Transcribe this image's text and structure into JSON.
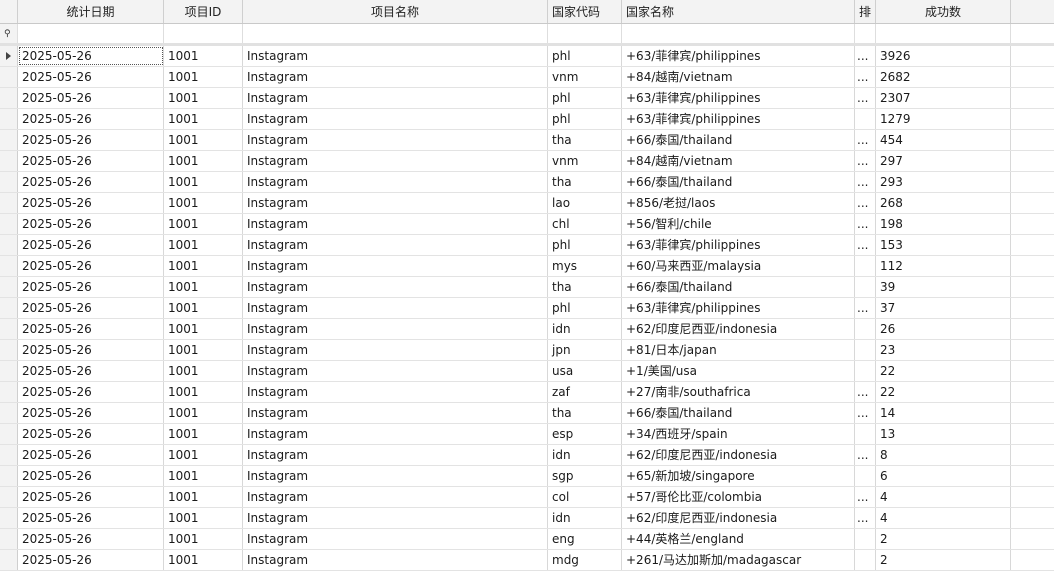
{
  "columns": {
    "date": "统计日期",
    "project_id": "项目ID",
    "project_name": "项目名称",
    "country_code": "国家代码",
    "country_name": "国家名称",
    "truncated": "排",
    "success": "成功数"
  },
  "rows": [
    {
      "date": "2025-05-26",
      "pid": "1001",
      "pname": "Instagram",
      "cc": "phl",
      "cname": "+63/菲律宾/philippines",
      "x": "...",
      "succ": "3926"
    },
    {
      "date": "2025-05-26",
      "pid": "1001",
      "pname": "Instagram",
      "cc": "vnm",
      "cname": "+84/越南/vietnam",
      "x": "...",
      "succ": "2682"
    },
    {
      "date": "2025-05-26",
      "pid": "1001",
      "pname": "Instagram",
      "cc": "phl",
      "cname": "+63/菲律宾/philippines",
      "x": "...",
      "succ": "2307"
    },
    {
      "date": "2025-05-26",
      "pid": "1001",
      "pname": "Instagram",
      "cc": "phl",
      "cname": "+63/菲律宾/philippines",
      "x": "",
      "succ": "1279"
    },
    {
      "date": "2025-05-26",
      "pid": "1001",
      "pname": "Instagram",
      "cc": "tha",
      "cname": "+66/泰国/thailand",
      "x": "...",
      "succ": "454"
    },
    {
      "date": "2025-05-26",
      "pid": "1001",
      "pname": "Instagram",
      "cc": "vnm",
      "cname": "+84/越南/vietnam",
      "x": "...",
      "succ": "297"
    },
    {
      "date": "2025-05-26",
      "pid": "1001",
      "pname": "Instagram",
      "cc": "tha",
      "cname": "+66/泰国/thailand",
      "x": "...",
      "succ": "293"
    },
    {
      "date": "2025-05-26",
      "pid": "1001",
      "pname": "Instagram",
      "cc": "lao",
      "cname": "+856/老挝/laos",
      "x": "...",
      "succ": "268"
    },
    {
      "date": "2025-05-26",
      "pid": "1001",
      "pname": "Instagram",
      "cc": "chl",
      "cname": "+56/智利/chile",
      "x": "...",
      "succ": "198"
    },
    {
      "date": "2025-05-26",
      "pid": "1001",
      "pname": "Instagram",
      "cc": "phl",
      "cname": "+63/菲律宾/philippines",
      "x": "...",
      "succ": "153"
    },
    {
      "date": "2025-05-26",
      "pid": "1001",
      "pname": "Instagram",
      "cc": "mys",
      "cname": "+60/马来西亚/malaysia",
      "x": "",
      "succ": "112"
    },
    {
      "date": "2025-05-26",
      "pid": "1001",
      "pname": "Instagram",
      "cc": "tha",
      "cname": "+66/泰国/thailand",
      "x": "",
      "succ": "39"
    },
    {
      "date": "2025-05-26",
      "pid": "1001",
      "pname": "Instagram",
      "cc": "phl",
      "cname": "+63/菲律宾/philippines",
      "x": "...",
      "succ": "37"
    },
    {
      "date": "2025-05-26",
      "pid": "1001",
      "pname": "Instagram",
      "cc": "idn",
      "cname": "+62/印度尼西亚/indonesia",
      "x": "",
      "succ": "26"
    },
    {
      "date": "2025-05-26",
      "pid": "1001",
      "pname": "Instagram",
      "cc": "jpn",
      "cname": "+81/日本/japan",
      "x": "",
      "succ": "23"
    },
    {
      "date": "2025-05-26",
      "pid": "1001",
      "pname": "Instagram",
      "cc": "usa",
      "cname": "+1/美国/usa",
      "x": "",
      "succ": "22"
    },
    {
      "date": "2025-05-26",
      "pid": "1001",
      "pname": "Instagram",
      "cc": "zaf",
      "cname": "+27/南非/southafrica",
      "x": "...",
      "succ": "22"
    },
    {
      "date": "2025-05-26",
      "pid": "1001",
      "pname": "Instagram",
      "cc": "tha",
      "cname": "+66/泰国/thailand",
      "x": "...",
      "succ": "14"
    },
    {
      "date": "2025-05-26",
      "pid": "1001",
      "pname": "Instagram",
      "cc": "esp",
      "cname": "+34/西班牙/spain",
      "x": "",
      "succ": "13"
    },
    {
      "date": "2025-05-26",
      "pid": "1001",
      "pname": "Instagram",
      "cc": "idn",
      "cname": "+62/印度尼西亚/indonesia",
      "x": "...",
      "succ": "8"
    },
    {
      "date": "2025-05-26",
      "pid": "1001",
      "pname": "Instagram",
      "cc": "sgp",
      "cname": "+65/新加坡/singapore",
      "x": "",
      "succ": "6"
    },
    {
      "date": "2025-05-26",
      "pid": "1001",
      "pname": "Instagram",
      "cc": "col",
      "cname": "+57/哥伦比亚/colombia",
      "x": "...",
      "succ": "4"
    },
    {
      "date": "2025-05-26",
      "pid": "1001",
      "pname": "Instagram",
      "cc": "idn",
      "cname": "+62/印度尼西亚/indonesia",
      "x": "...",
      "succ": "4"
    },
    {
      "date": "2025-05-26",
      "pid": "1001",
      "pname": "Instagram",
      "cc": "eng",
      "cname": "+44/英格兰/england",
      "x": "",
      "succ": "2"
    },
    {
      "date": "2025-05-26",
      "pid": "1001",
      "pname": "Instagram",
      "cc": "mdg",
      "cname": "+261/马达加斯加/madagascar",
      "x": "",
      "succ": "2"
    }
  ]
}
